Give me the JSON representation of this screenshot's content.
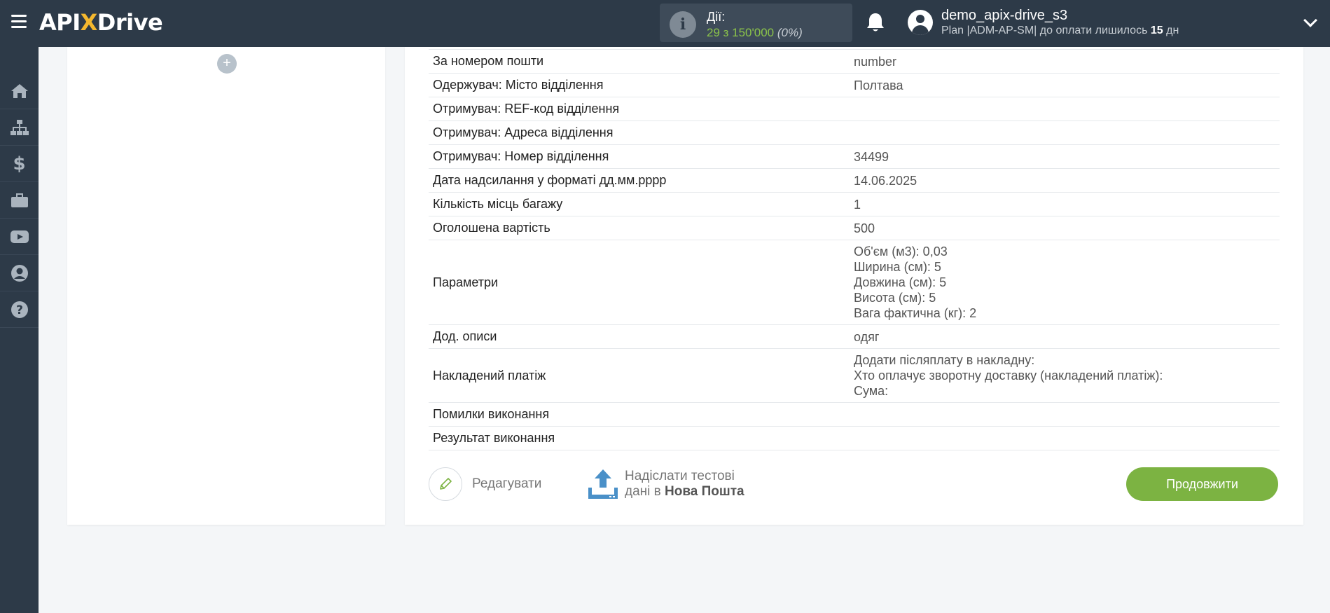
{
  "header": {
    "logo_api": "API",
    "logo_x": "X",
    "logo_drive": "Drive",
    "actions_label": "Дії:",
    "actions_count": "29 з 150'000",
    "actions_percent": "(0%)",
    "user_name": "demo_apix-drive_s3",
    "plan_prefix": "Plan |ADM-AP-SM| до оплати лишилось",
    "plan_days": "15",
    "plan_suffix": "дн"
  },
  "sidebar": {
    "items": [
      "home-icon",
      "sitemap-icon",
      "dollar-icon",
      "briefcase-icon",
      "youtube-icon",
      "user-icon",
      "help-icon"
    ]
  },
  "left_panel": {
    "add_symbol": "+"
  },
  "table": {
    "rows": [
      {
        "key": "За номером пошти",
        "values": [
          "number"
        ]
      },
      {
        "key": "Одержувач: Місто відділення",
        "values": [
          "Полтава"
        ]
      },
      {
        "key": "Отримувач: REF-код відділення",
        "values": []
      },
      {
        "key": "Отримувач: Адреса відділення",
        "values": []
      },
      {
        "key": "Отримувач: Номер відділення",
        "values": [
          "34499"
        ]
      },
      {
        "key": "Дата надсилання у форматі дд.мм.рррр",
        "values": [
          "14.06.2025"
        ]
      },
      {
        "key": "Кількість місць багажу",
        "values": [
          "1"
        ]
      },
      {
        "key": "Оголошена вартість",
        "values": [
          "500"
        ]
      },
      {
        "key": "Параметри",
        "values": [
          "Об'єм (м3): 0,03",
          "Ширина (см): 5",
          "Довжина (см): 5",
          "Висота (см): 5",
          "Вага фактична (кг): 2"
        ]
      },
      {
        "key": "Дод. описи",
        "values": [
          "одяг"
        ]
      },
      {
        "key": "Накладений платіж",
        "values": [
          "Додати післяплату в накладну:",
          "Хто оплачує зворотну доставку (накладений платіж):",
          "Сума:"
        ]
      },
      {
        "key": "Помилки виконання",
        "values": []
      },
      {
        "key": "Результат виконання",
        "values": []
      }
    ]
  },
  "buttons": {
    "edit_label": "Редагувати",
    "send_line1": "Надіслати тестові",
    "send_line2_prefix": "дані в",
    "send_target": "Нова Пошта",
    "continue_label": "Продовжити"
  },
  "colors": {
    "header_bg": "#2d3a48",
    "accent_green": "#7cb342",
    "logo_x": "#f5b82e",
    "upload_icon": "#4a90c8"
  }
}
